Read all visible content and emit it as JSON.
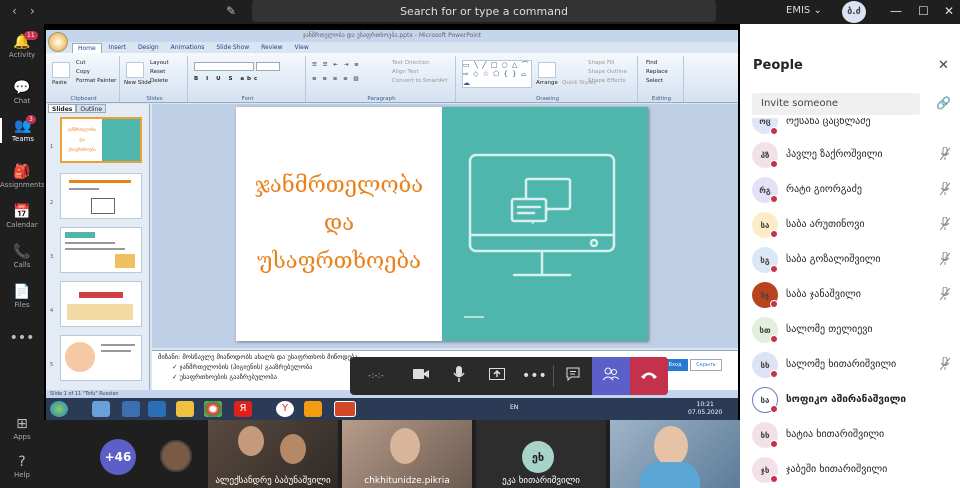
{
  "topbar": {
    "back": "‹",
    "forward": "›",
    "compose_icon": "compose-icon",
    "search_placeholder": "Search for or type a command",
    "tenant": "EMIS",
    "tenant_chevron": "⌄",
    "avatar_initials": "ბ.ძ",
    "min": "—",
    "max": "☐",
    "close": "✕"
  },
  "rail": [
    {
      "label": "Activity",
      "icon": "bell-icon",
      "glyph": "🔔",
      "badge": "11"
    },
    {
      "label": "Chat",
      "icon": "chat-icon",
      "glyph": "💬",
      "badge": ""
    },
    {
      "label": "Teams",
      "icon": "teams-icon",
      "glyph": "👥",
      "badge": "3"
    },
    {
      "label": "Assignments",
      "icon": "assignments-icon",
      "glyph": "🎒",
      "badge": ""
    },
    {
      "label": "Calendar",
      "icon": "calendar-icon",
      "glyph": "📅",
      "badge": ""
    },
    {
      "label": "Calls",
      "icon": "phone-icon",
      "glyph": "📞",
      "badge": ""
    },
    {
      "label": "Files",
      "icon": "file-icon",
      "glyph": "📄",
      "badge": ""
    },
    {
      "label": "",
      "icon": "more-icon",
      "glyph": "•••",
      "badge": ""
    },
    {
      "label": "Apps",
      "icon": "apps-icon",
      "glyph": "⊞",
      "badge": ""
    },
    {
      "label": "Help",
      "icon": "help-icon",
      "glyph": "?",
      "badge": ""
    }
  ],
  "ppt": {
    "title": "ჯანმრთელობა და უსაფრთხოება.pptx - Microsoft PowerPoint",
    "tabs": [
      "Home",
      "Insert",
      "Design",
      "Animations",
      "Slide Show",
      "Review",
      "View"
    ],
    "groups": {
      "clipboard": "Clipboard",
      "slides": "Slides",
      "font": "Font",
      "paragraph": "Paragraph",
      "drawing": "Drawing",
      "editing": "Editing"
    },
    "clipboard_items": {
      "paste": "Paste",
      "cut": "Cut",
      "copy": "Copy",
      "format_painter": "Format Painter"
    },
    "slides_items": {
      "new_slide": "New Slide",
      "layout": "Layout",
      "reset": "Reset",
      "delete": "Delete"
    },
    "paragraph_items": {
      "text_direction": "Text Direction",
      "align_text": "Align Text",
      "convert": "Convert to SmartArt"
    },
    "drawing_items": {
      "arrange": "Arrange",
      "quick_styles": "Quick Styles",
      "shape_fill": "Shape Fill",
      "shape_outline": "Shape Outline",
      "shape_effects": "Shape Effects"
    },
    "editing_items": {
      "find": "Find",
      "replace": "Replace",
      "select": "Select"
    },
    "pane_tabs": [
      "Slides",
      "Outline"
    ],
    "thumb_numbers": [
      "1",
      "2",
      "3",
      "4",
      "5"
    ],
    "slide_lines": [
      "ჯანმრთელობა",
      "და",
      "უსაფრთხოება"
    ],
    "notes": [
      "მიზანი: მოსწავლე მიაწოდობს ახალს და უსაფრთხოს მიწოდება",
      "ჯანმრთელობის (ჰიგიენის) გააზრებულობა",
      "უსაფრთხოების გააზრებულობა"
    ],
    "notes_btn_blue": "Вход",
    "notes_btn": "Скрыть",
    "status": "Slide 1 of 11    \"Tofu\"    Russian",
    "clock_time": "10:21",
    "clock_date": "07.05.2020",
    "lang": "EN"
  },
  "controls": {
    "timer": "-:-:-",
    "camera": "camera-icon",
    "mic": "mic-icon",
    "share": "share-tray-icon",
    "more": "•••",
    "chat": "chat-icon",
    "participants": "participants-icon",
    "hangup": "hangup-icon"
  },
  "videos": {
    "more_count": "+46",
    "tiles": [
      "ალექსანდრე ბაბუნაშვილი",
      "chkhitunidze.pikria",
      "ეკა ხითარიშვილი"
    ],
    "avatar_initials": "ეხ"
  },
  "people": {
    "title": "People",
    "invite_placeholder": "Invite someone",
    "list": [
      {
        "name": "ოქსანა ცაცხლაძე",
        "initials": "ოც",
        "color": "#dfe6f7",
        "mic": false,
        "bold": false
      },
      {
        "name": "პავლე ზაქროშვილი",
        "initials": "პზ",
        "color": "#f2e1e8",
        "mic": true,
        "bold": false
      },
      {
        "name": "რატი გიორგაძე",
        "initials": "რგ",
        "color": "#e5e0f5",
        "mic": true,
        "bold": false
      },
      {
        "name": "საბა არუთინოვი",
        "initials": "სა",
        "color": "#fbecc7",
        "mic": true,
        "bold": false
      },
      {
        "name": "საბა გოზალიშვილი",
        "initials": "სგ",
        "color": "#dbe7f7",
        "mic": true,
        "bold": false
      },
      {
        "name": "საბა ჯანაშვილი",
        "initials": "სჯ",
        "color": "#b8441e",
        "mic": true,
        "bold": false
      },
      {
        "name": "სალომე თელიევი",
        "initials": "სთ",
        "color": "#e2efdc",
        "mic": false,
        "bold": false
      },
      {
        "name": "სალომე ხითარიშვილი",
        "initials": "სხ",
        "color": "#dbe3f4",
        "mic": true,
        "bold": false
      },
      {
        "name": "სოფიკო აშირანაშვილი",
        "initials": "სა",
        "color": "#fff",
        "mic": false,
        "bold": true
      },
      {
        "name": "ხატია ხითარიშვილი",
        "initials": "ხხ",
        "color": "#f2e1e8",
        "mic": false,
        "bold": false
      },
      {
        "name": "ჯაბეში ხითარიშვილი",
        "initials": "ჯხ",
        "color": "#f2e1e8",
        "mic": false,
        "bold": false
      }
    ]
  }
}
